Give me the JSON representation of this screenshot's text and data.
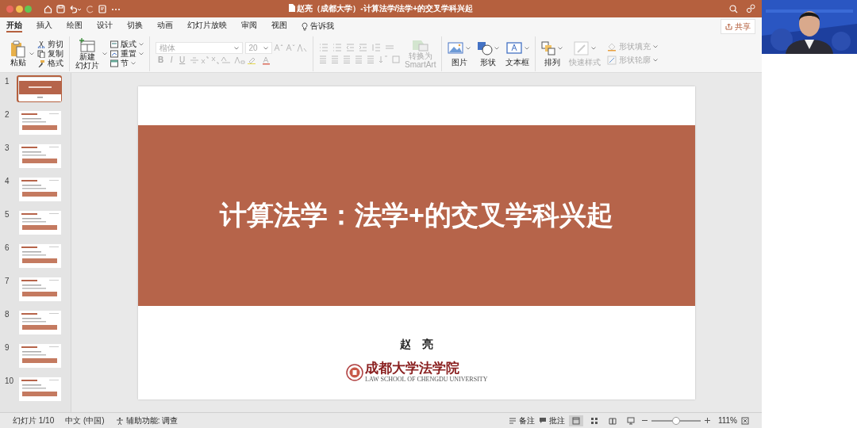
{
  "window": {
    "title": "赵亮（成都大学）-计算法学/法学+的交叉学科兴起"
  },
  "ribbon_tabs": [
    {
      "label": "开始",
      "selected": true
    },
    {
      "label": "插入",
      "selected": false
    },
    {
      "label": "绘图",
      "selected": false
    },
    {
      "label": "设计",
      "selected": false
    },
    {
      "label": "切换",
      "selected": false
    },
    {
      "label": "动画",
      "selected": false
    },
    {
      "label": "幻灯片放映",
      "selected": false
    },
    {
      "label": "审阅",
      "selected": false
    },
    {
      "label": "视图",
      "selected": false
    }
  ],
  "tell_me": "告诉我",
  "share_button": "共享",
  "ribbon": {
    "clipboard": {
      "paste": "粘贴",
      "actions": [
        {
          "kind": "cut",
          "label": "剪切"
        },
        {
          "kind": "copy",
          "label": "复制"
        },
        {
          "kind": "painter",
          "label": "格式"
        }
      ]
    },
    "slides": {
      "new_slide": [
        "新建",
        "幻灯片"
      ],
      "actions": [
        {
          "kind": "layout",
          "label": "版式"
        },
        {
          "kind": "reset",
          "label": "重置"
        },
        {
          "kind": "section",
          "label": "节"
        }
      ]
    },
    "font": {
      "name": "楷体",
      "size": "20",
      "disabled": true,
      "styles": [
        "B",
        "I",
        "U"
      ]
    },
    "smartart": {
      "lines": [
        "转换为",
        "SmartArt"
      ],
      "disabled": true
    },
    "insert": [
      {
        "kind": "picture",
        "label": "图片"
      },
      {
        "kind": "shape",
        "label": "形状"
      },
      {
        "kind": "textbox",
        "label": "文本框"
      }
    ],
    "arrange": "排列",
    "quick_styles": {
      "label": "快速样式",
      "disabled": true
    },
    "shape_format": [
      {
        "kind": "fill",
        "label": "形状填充",
        "disabled": true
      },
      {
        "kind": "outline",
        "label": "形状轮廓",
        "disabled": true
      }
    ]
  },
  "thumbnails": [
    {
      "number": "1",
      "kind": "title",
      "selected": true
    },
    {
      "number": "2",
      "kind": "content",
      "selected": false
    },
    {
      "number": "3",
      "kind": "content",
      "selected": false
    },
    {
      "number": "4",
      "kind": "content",
      "selected": false
    },
    {
      "number": "5",
      "kind": "content",
      "selected": false
    },
    {
      "number": "6",
      "kind": "content",
      "selected": false
    },
    {
      "number": "7",
      "kind": "content",
      "selected": false
    },
    {
      "number": "8",
      "kind": "content",
      "selected": false
    },
    {
      "number": "9",
      "kind": "content",
      "selected": false
    },
    {
      "number": "10",
      "kind": "content",
      "selected": false
    }
  ],
  "slide": {
    "title": "计算法学：法学+的交叉学科兴起",
    "author": "赵　亮",
    "logo_name": "成都大学法学院",
    "logo_subtitle": "LAW SCHOOL OF CHENGDU UNIVERSITY"
  },
  "status_bar": {
    "slide_position": "幻灯片 1/10",
    "language": "中文 (中国)",
    "accessibility": "辅助功能: 调查",
    "notes": "备注",
    "comments": "批注",
    "views": [
      {
        "kind": "normal",
        "selected": true
      },
      {
        "kind": "sorter",
        "selected": false
      },
      {
        "kind": "reading",
        "selected": false
      },
      {
        "kind": "slideshow",
        "selected": false
      }
    ],
    "zoom": {
      "level": 0.5,
      "reading": "111%"
    }
  }
}
